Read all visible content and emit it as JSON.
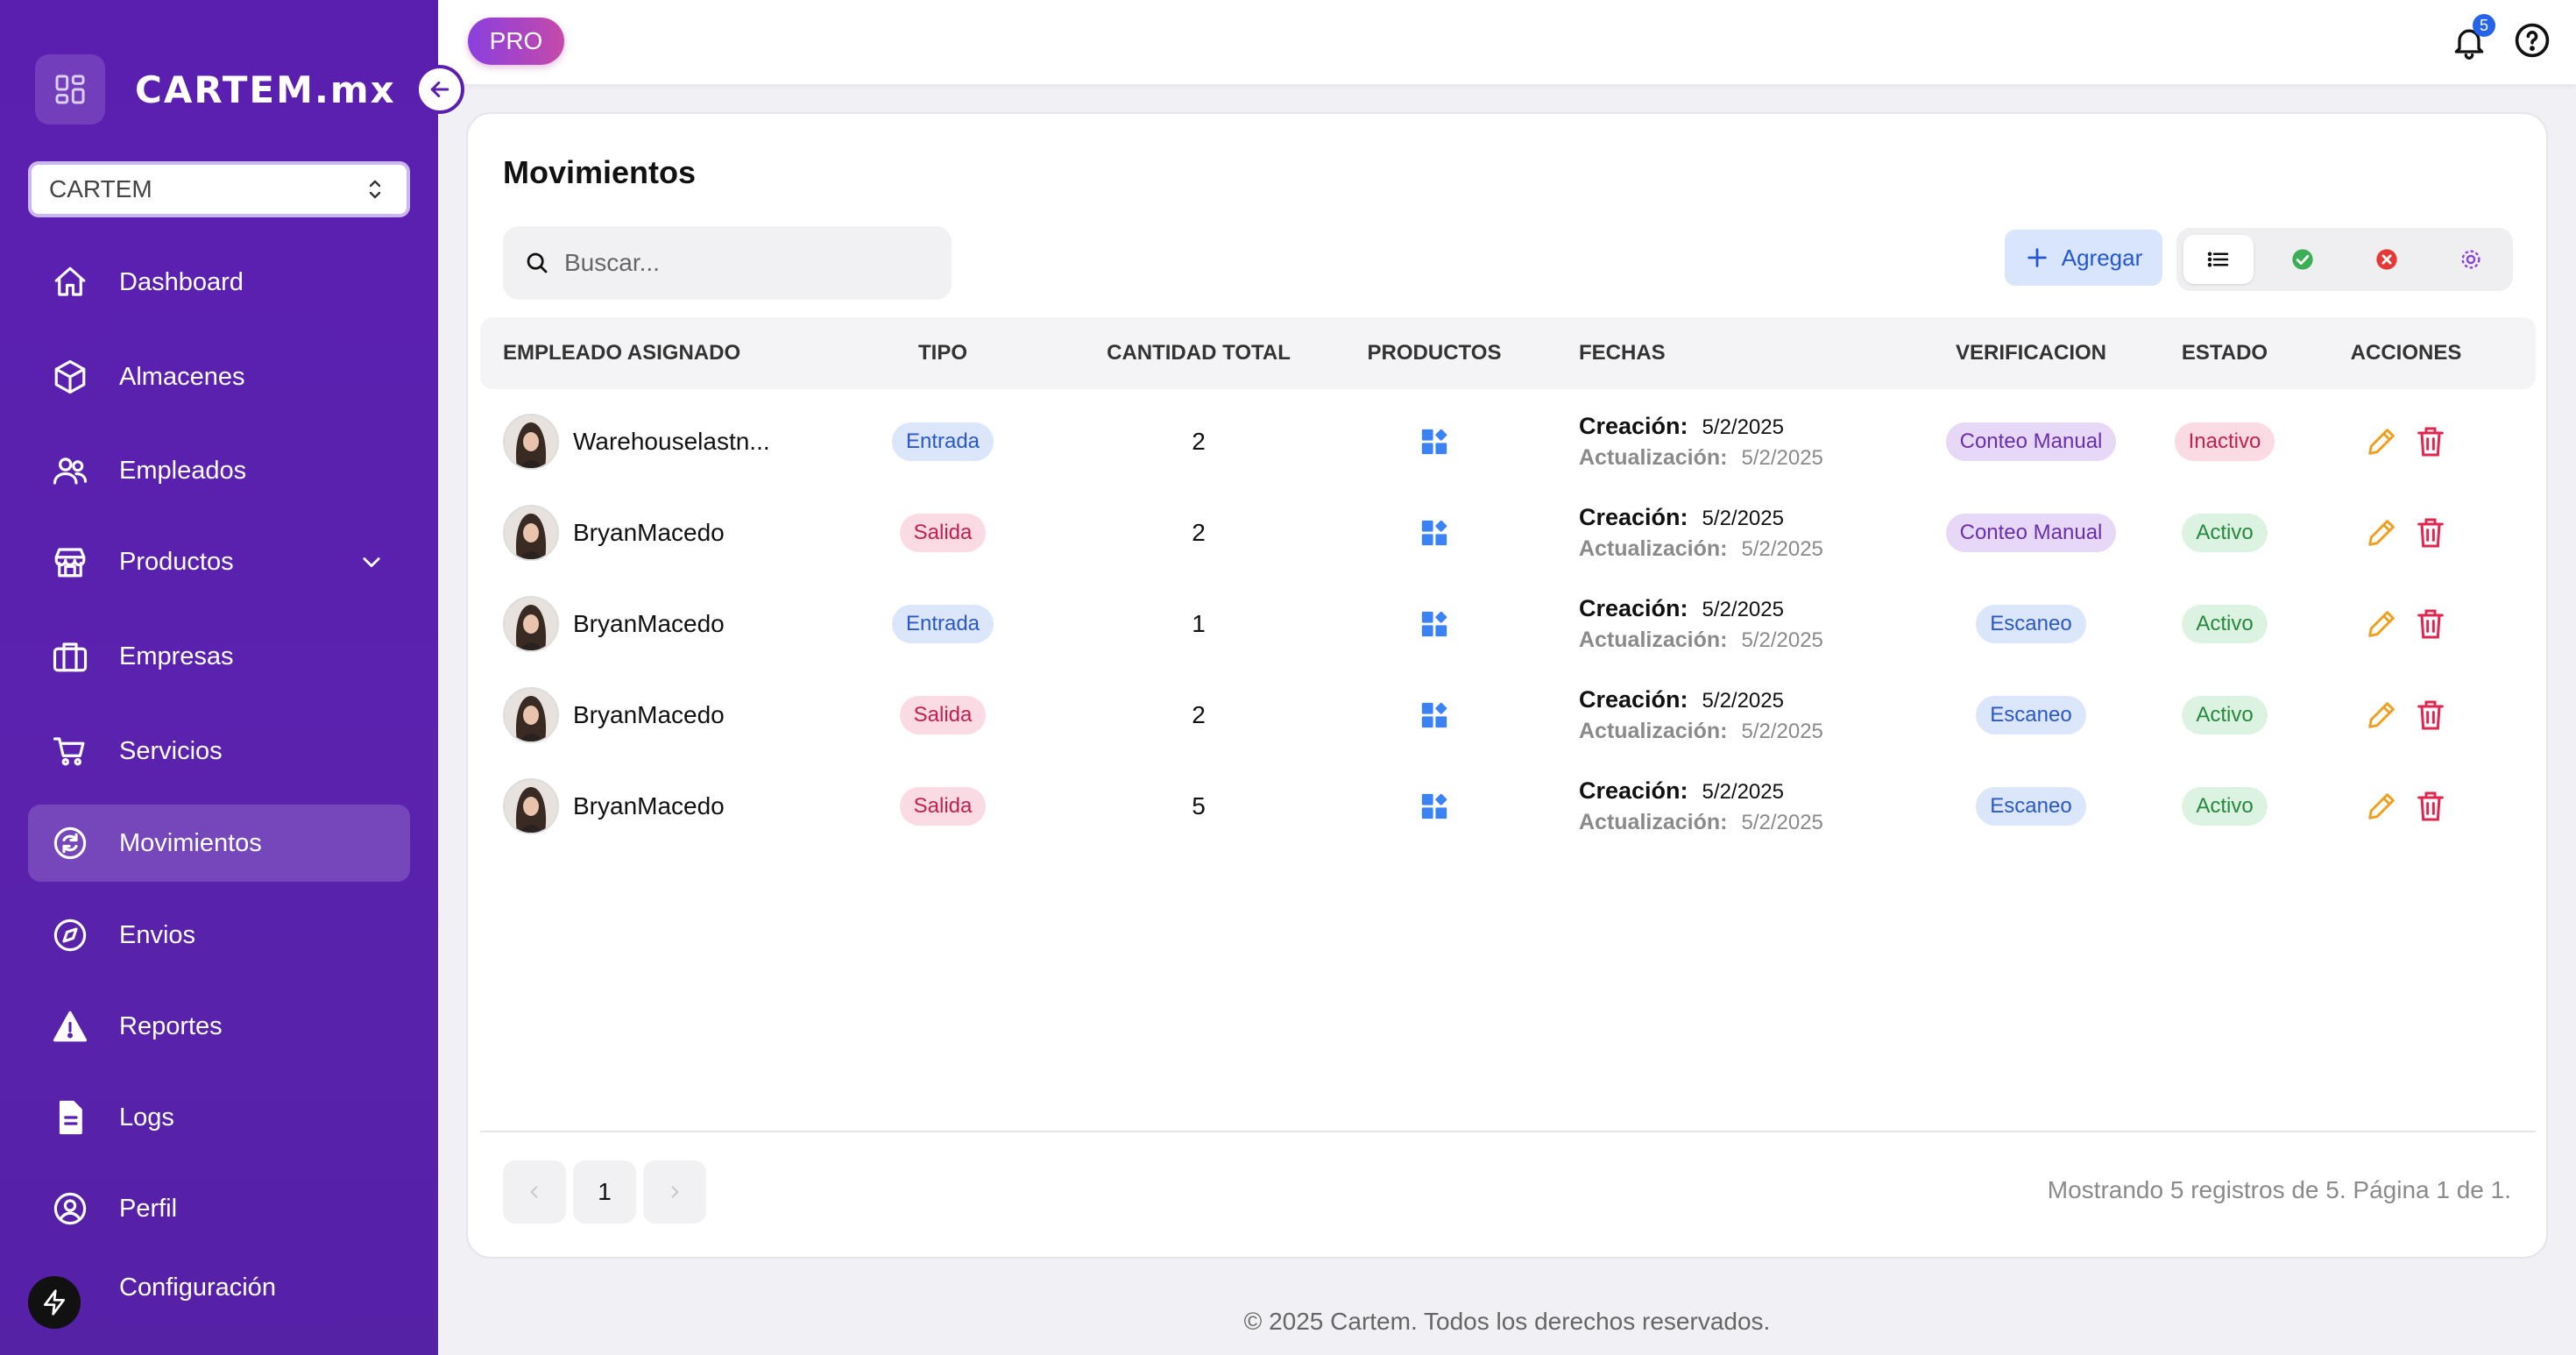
{
  "brand": {
    "name": "CARTEM.mx"
  },
  "company_select": {
    "value": "CARTEM"
  },
  "sidebar": {
    "items": [
      {
        "label": "Dashboard",
        "icon": "home-icon"
      },
      {
        "label": "Almacenes",
        "icon": "box-icon"
      },
      {
        "label": "Empleados",
        "icon": "users-icon"
      },
      {
        "label": "Productos",
        "icon": "store-icon"
      },
      {
        "label": "Empresas",
        "icon": "briefcase-icon"
      },
      {
        "label": "Servicios",
        "icon": "cart-icon"
      },
      {
        "label": "Movimientos",
        "icon": "refresh-icon",
        "active": true
      },
      {
        "label": "Envios",
        "icon": "compass-icon"
      },
      {
        "label": "Reportes",
        "icon": "warning-icon"
      },
      {
        "label": "Logs",
        "icon": "document-icon"
      },
      {
        "label": "Perfil",
        "icon": "user-circle-icon"
      },
      {
        "label": "Configuración",
        "icon": "gear-icon"
      }
    ]
  },
  "topbar": {
    "badge": "PRO",
    "notifications_count": "5"
  },
  "main": {
    "title": "Movimientos",
    "search_placeholder": "Buscar...",
    "add_label": "Agregar",
    "colors": {
      "accent": "#5b1fb0",
      "primary_blue": "#2457d6"
    }
  },
  "table": {
    "headers": [
      "EMPLEADO ASIGNADO",
      "TIPO",
      "CANTIDAD TOTAL",
      "PRODUCTOS",
      "FECHAS",
      "VERIFICACION",
      "ESTADO",
      "ACCIONES"
    ],
    "creation_label": "Creación:",
    "update_label": "Actualización:",
    "rows": [
      {
        "employee": "Warehouselastn...",
        "type": "Entrada",
        "qty": "2",
        "created": "5/2/2025",
        "updated": "5/2/2025",
        "verification": "Conteo Manual",
        "status": "Inactivo"
      },
      {
        "employee": "BryanMacedo",
        "type": "Salida",
        "qty": "2",
        "created": "5/2/2025",
        "updated": "5/2/2025",
        "verification": "Conteo Manual",
        "status": "Activo"
      },
      {
        "employee": "BryanMacedo",
        "type": "Entrada",
        "qty": "1",
        "created": "5/2/2025",
        "updated": "5/2/2025",
        "verification": "Escaneo",
        "status": "Activo"
      },
      {
        "employee": "BryanMacedo",
        "type": "Salida",
        "qty": "2",
        "created": "5/2/2025",
        "updated": "5/2/2025",
        "verification": "Escaneo",
        "status": "Activo"
      },
      {
        "employee": "BryanMacedo",
        "type": "Salida",
        "qty": "5",
        "created": "5/2/2025",
        "updated": "5/2/2025",
        "verification": "Escaneo",
        "status": "Activo"
      }
    ]
  },
  "pagination": {
    "current_page": "1",
    "info": "Mostrando 5 registros de 5. Página 1 de 1."
  },
  "footer": {
    "text": "© 2025 Cartem. Todos los derechos reservados."
  }
}
